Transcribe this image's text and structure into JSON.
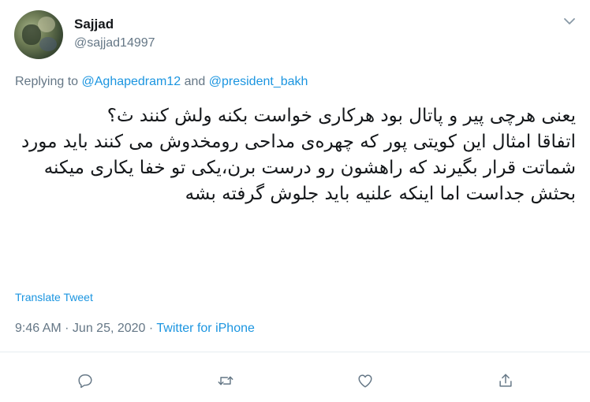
{
  "user": {
    "display_name": "Sajjad",
    "handle": "@sajjad14997"
  },
  "replying": {
    "prefix": "Replying to ",
    "mention1": "@Aghapedram12",
    "conjunction": " and ",
    "mention2": "@president_bakh"
  },
  "tweet": {
    "text": "یعنی هرچی پیر و پاتال بود هرکاری خواست بکنه ولش کنند ث؟\nاتفاقا امثال این کویتی پور که چهره‌ی مداحی رومخدوش می کنند باید مورد شماتت قرار بگیرند که راهشون رو درست برن،یکی تو خفا یکاری میکنه بحثش جداست اما اینکه علنیه باید جلوش گرفته بشه"
  },
  "translate_label": "Translate Tweet",
  "meta": {
    "time": "9:46 AM",
    "separator1": " · ",
    "date": "Jun 25, 2020",
    "separator2": " · ",
    "source": "Twitter for iPhone"
  },
  "icons": {
    "caret": "chevron-down-icon",
    "reply": "reply-icon",
    "retweet": "retweet-icon",
    "like": "heart-icon",
    "share": "share-icon"
  },
  "colors": {
    "text": "#14171a",
    "secondary": "#657786",
    "link": "#1b95e0",
    "divider": "#e6ecf0"
  }
}
